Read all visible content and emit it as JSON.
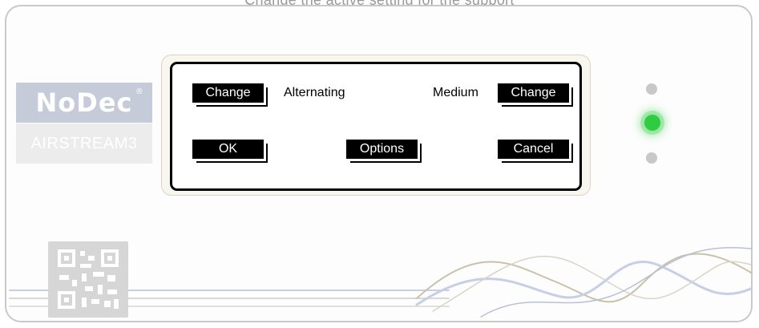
{
  "header": {
    "caption": "Change the active setting for the support"
  },
  "brand": {
    "logo_text": "NoDec",
    "registered_mark": "®",
    "model_text": "AIRSTREAM3"
  },
  "lcd": {
    "left_change_label": "Change",
    "mode_value": "Alternating",
    "level_value": "Medium",
    "right_change_label": "Change",
    "ok_label": "OK",
    "options_label": "Options",
    "cancel_label": "Cancel"
  },
  "indicators": [
    {
      "name": "top",
      "state": "off",
      "color": "#c8c8c8"
    },
    {
      "name": "middle",
      "state": "on",
      "color": "#2ecc40"
    },
    {
      "name": "bottom",
      "state": "off",
      "color": "#c8c8c8"
    }
  ],
  "icons": {
    "qr": "qr-code-icon",
    "decor": "wave-decoration"
  }
}
